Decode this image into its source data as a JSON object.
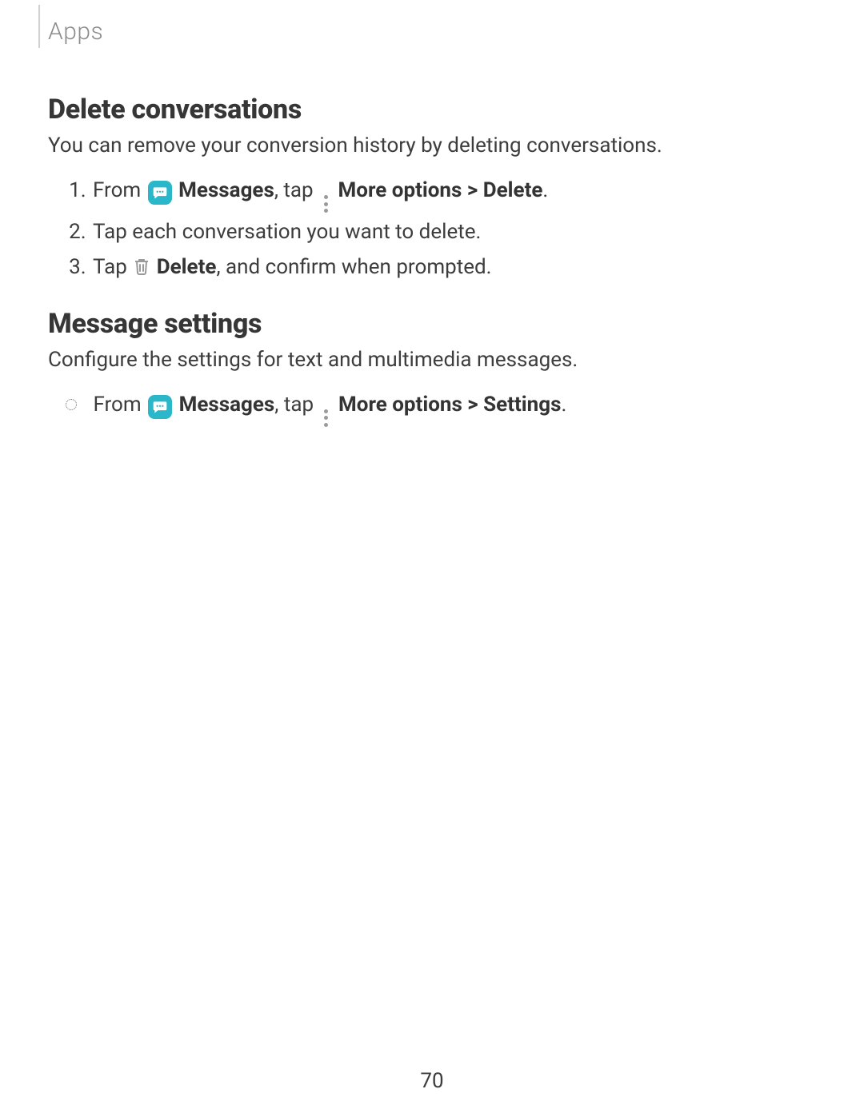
{
  "header": {
    "breadcrumb": "Apps"
  },
  "sections": {
    "delete": {
      "heading": "Delete conversations",
      "body": "You can remove your conversion history by deleting conversations.",
      "step1_from": "From ",
      "step1_messages": "Messages",
      "step1_tap": ", tap ",
      "step1_more_options": "More options",
      "step1_gt": " > ",
      "step1_delete": "Delete",
      "step1_period": ".",
      "step2": "Tap each conversation you want to delete.",
      "step3_tap": "Tap ",
      "step3_delete": "Delete",
      "step3_tail": ", and confirm when prompted."
    },
    "settings": {
      "heading": "Message settings",
      "body": "Configure the settings for text and multimedia messages.",
      "step_from": "From ",
      "step_messages": "Messages",
      "step_tap": ", tap ",
      "step_more_options": "More options",
      "step_gt": " > ",
      "step_settings": "Settings",
      "step_period": "."
    }
  },
  "page_number": "70"
}
